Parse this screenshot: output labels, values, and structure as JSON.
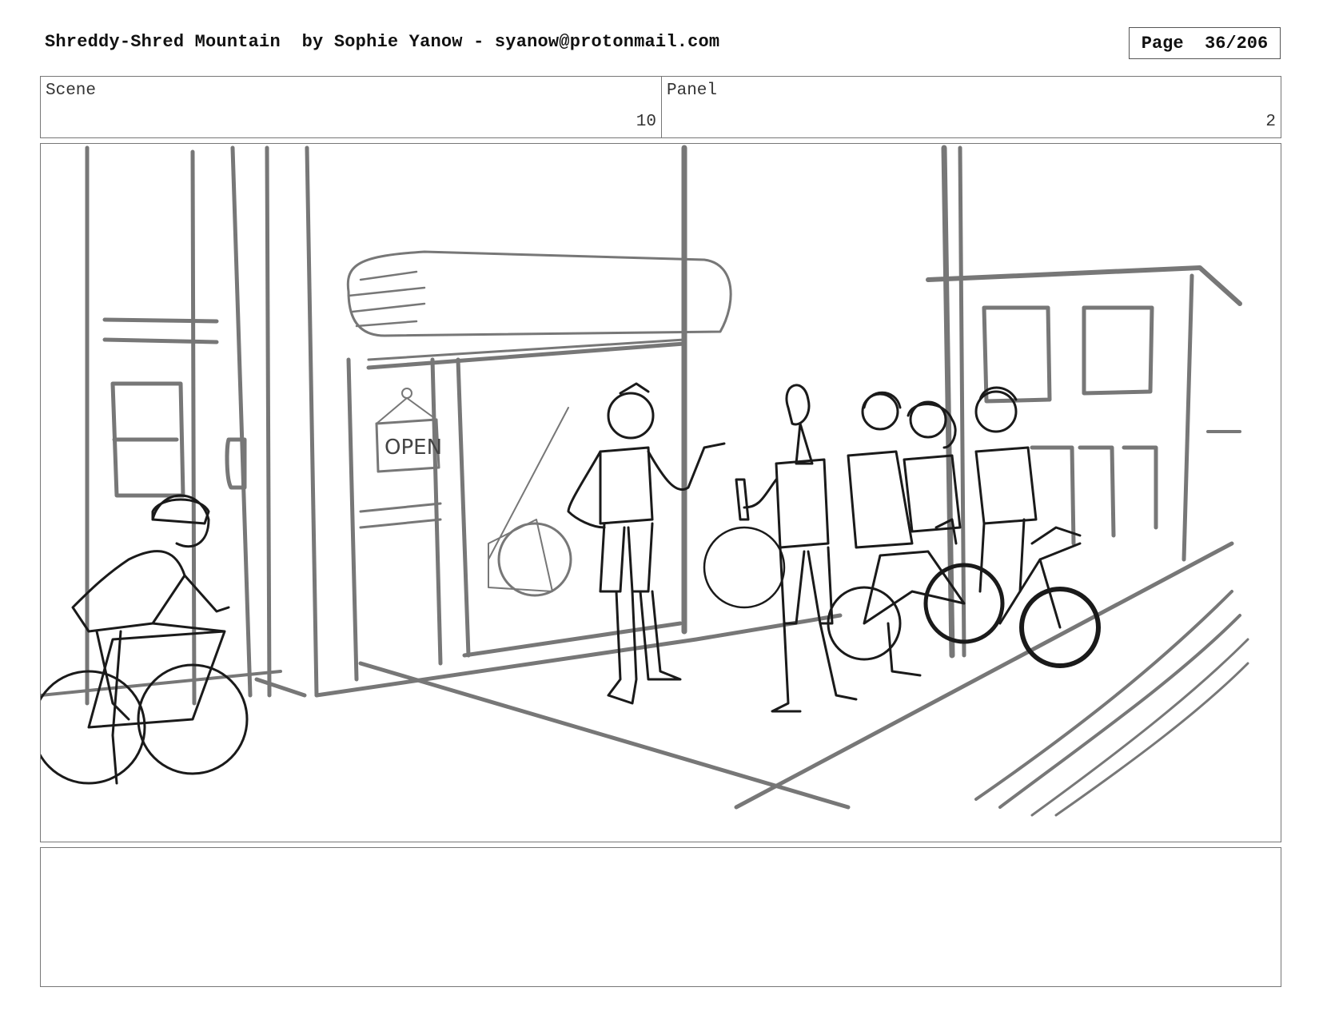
{
  "header": {
    "title": "Shreddy-Shred Mountain  by Sophie Yanow - syanow@protonmail.com",
    "page_label": "Page  36/206"
  },
  "scene": {
    "label": "Scene",
    "value": "10"
  },
  "panel": {
    "label": "Panel",
    "value": "2"
  },
  "illustration": {
    "shop_sign": "OPEN",
    "description_icon": "storyboard-sketch"
  },
  "notes": {
    "text": ""
  }
}
